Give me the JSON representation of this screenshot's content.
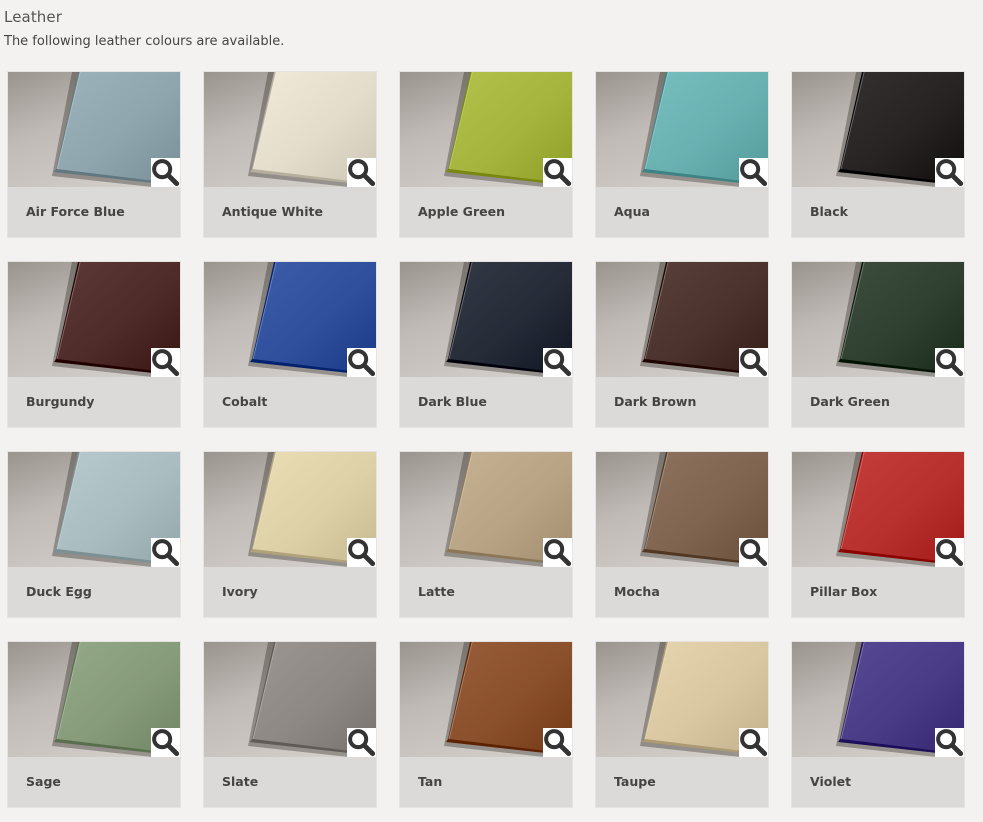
{
  "heading": {
    "title": "Leather",
    "subtitle": "The following leather colours are available."
  },
  "swatches": [
    {
      "name": "Air Force Blue",
      "color": "#8fa5ae"
    },
    {
      "name": "Antique White",
      "color": "#e3dccb"
    },
    {
      "name": "Apple Green",
      "color": "#a4b43c"
    },
    {
      "name": "Aqua",
      "color": "#69b0b1"
    },
    {
      "name": "Black",
      "color": "#262322"
    },
    {
      "name": "Burgundy",
      "color": "#4e2a28"
    },
    {
      "name": "Cobalt",
      "color": "#2f4f9c"
    },
    {
      "name": "Dark Blue",
      "color": "#262b38"
    },
    {
      "name": "Dark Brown",
      "color": "#4b322c"
    },
    {
      "name": "Dark Green",
      "color": "#2f3f30"
    },
    {
      "name": "Duck Egg",
      "color": "#a9bcc0"
    },
    {
      "name": "Ivory",
      "color": "#ddd0a6"
    },
    {
      "name": "Latte",
      "color": "#b8a385"
    },
    {
      "name": "Mocha",
      "color": "#7f6450"
    },
    {
      "name": "Pillar Box",
      "color": "#b8302d"
    },
    {
      "name": "Sage",
      "color": "#869b7a"
    },
    {
      "name": "Slate",
      "color": "#8d8884"
    },
    {
      "name": "Tan",
      "color": "#8a4f2b"
    },
    {
      "name": "Taupe",
      "color": "#d8c7a1"
    },
    {
      "name": "Violet",
      "color": "#4a3b86"
    }
  ],
  "icons": {
    "zoom": "search-icon"
  }
}
